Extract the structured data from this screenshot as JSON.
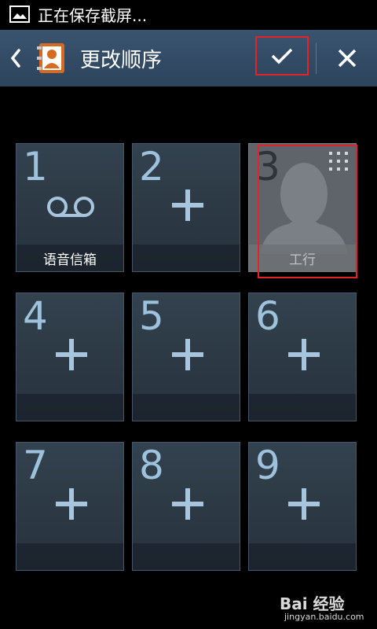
{
  "status_bar": {
    "text": "正在保存截屏...",
    "icon": "image-icon"
  },
  "header": {
    "title": "更改顺序",
    "back_icon": "chevron-left-icon",
    "app_icon": "contacts-app-icon",
    "done_icon": "checkmark-icon",
    "close_icon": "close-icon"
  },
  "tiles": [
    {
      "number": "1",
      "label": "语音信箱",
      "icon": "voicemail-icon"
    },
    {
      "number": "2",
      "label": "",
      "icon": "plus-icon"
    },
    {
      "number": "3",
      "label": "工行",
      "icon": "contact-avatar-icon"
    },
    {
      "number": "4",
      "label": "",
      "icon": "plus-icon"
    },
    {
      "number": "5",
      "label": "",
      "icon": "plus-icon"
    },
    {
      "number": "6",
      "label": "",
      "icon": "plus-icon"
    },
    {
      "number": "7",
      "label": "",
      "icon": "plus-icon"
    },
    {
      "number": "8",
      "label": "",
      "icon": "plus-icon"
    },
    {
      "number": "9",
      "label": "",
      "icon": "plus-icon"
    }
  ],
  "watermark": {
    "logo_text": "Bai 经验",
    "sub_text": "jingyan.baidu.com"
  },
  "colors": {
    "action_bar": "#2c435b",
    "tile_number": "#9fc2dc",
    "highlight": "#e2232a"
  }
}
